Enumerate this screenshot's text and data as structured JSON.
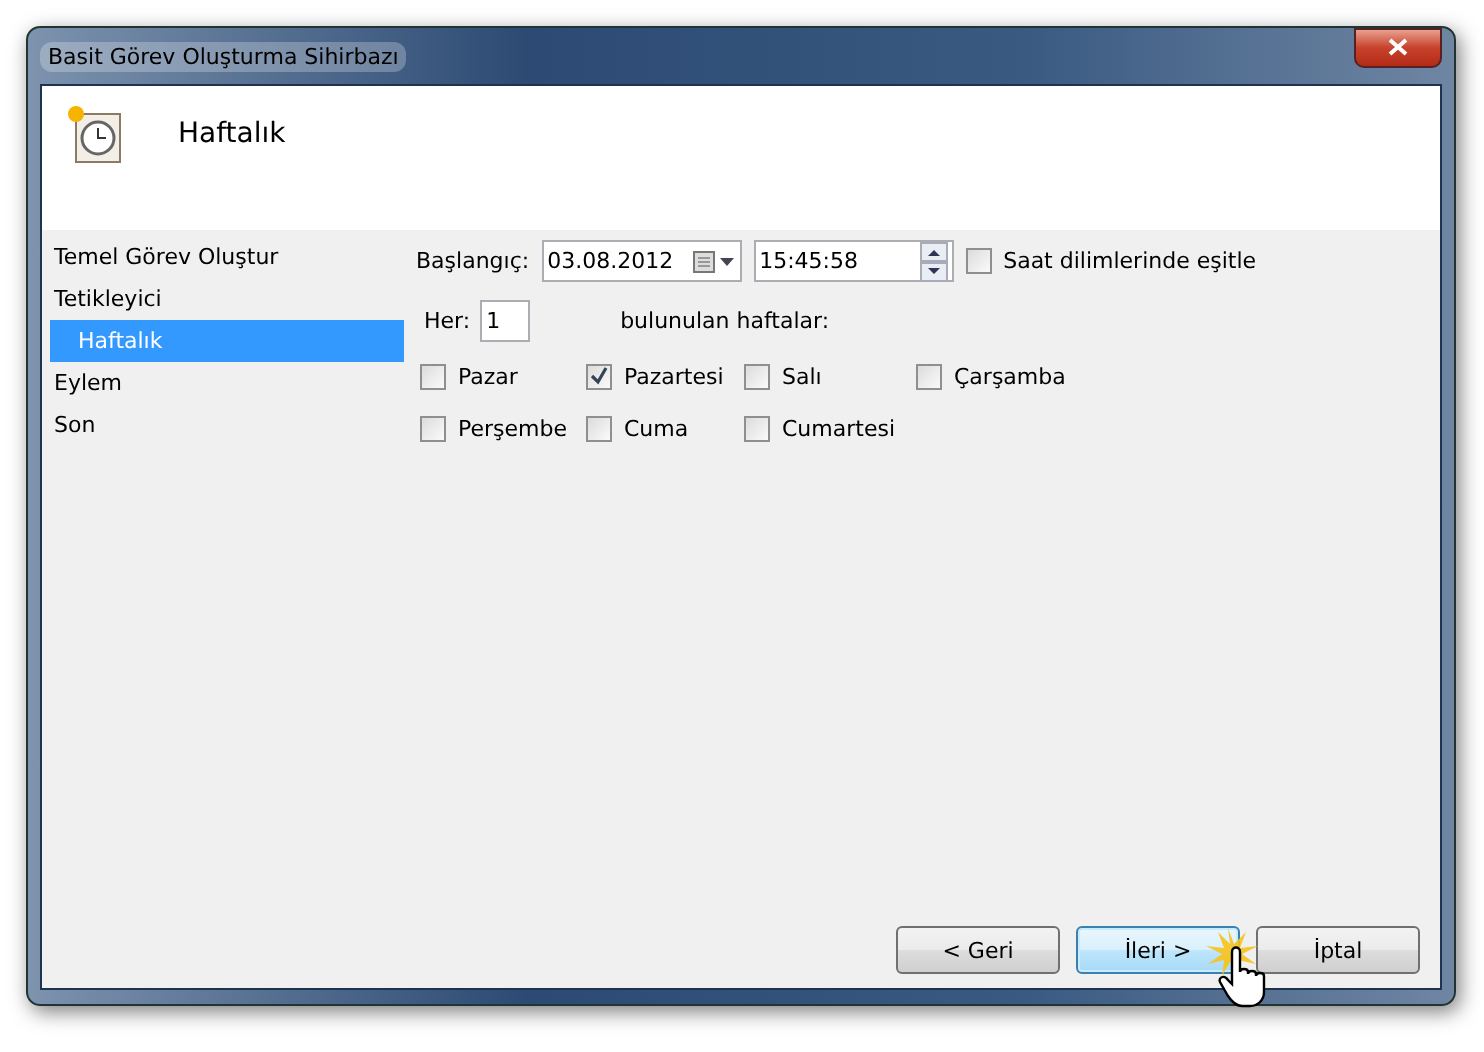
{
  "window": {
    "title": "Basit Görev Oluşturma Sihirbazı"
  },
  "header": {
    "title": "Haftalık"
  },
  "steps": [
    {
      "label": "Temel Görev Oluştur",
      "selected": false
    },
    {
      "label": "Tetikleyici",
      "selected": false,
      "children": [
        {
          "label": "Haftalık",
          "selected": true
        }
      ]
    },
    {
      "label": "Eylem",
      "selected": false
    },
    {
      "label": "Son",
      "selected": false
    }
  ],
  "start": {
    "label": "Başlangıç:",
    "date": "03.08.2012",
    "time": "15:45:58",
    "sync_label": "Saat dilimlerinde eşitle",
    "sync_checked": false
  },
  "recur": {
    "label": "Her:",
    "value": "1",
    "suffix": "bulunulan haftalar:"
  },
  "days": [
    {
      "label": "Pazar",
      "checked": false
    },
    {
      "label": "Pazartesi",
      "checked": true
    },
    {
      "label": "Salı",
      "checked": false
    },
    {
      "label": "Çarşamba",
      "checked": false
    },
    {
      "label": "Perşembe",
      "checked": false
    },
    {
      "label": "Cuma",
      "checked": false
    },
    {
      "label": "Cumartesi",
      "checked": false
    }
  ],
  "buttons": [
    {
      "label": "< Geri",
      "focused": false
    },
    {
      "label": "İleri >",
      "focused": true
    },
    {
      "label": "İptal",
      "focused": false
    }
  ]
}
